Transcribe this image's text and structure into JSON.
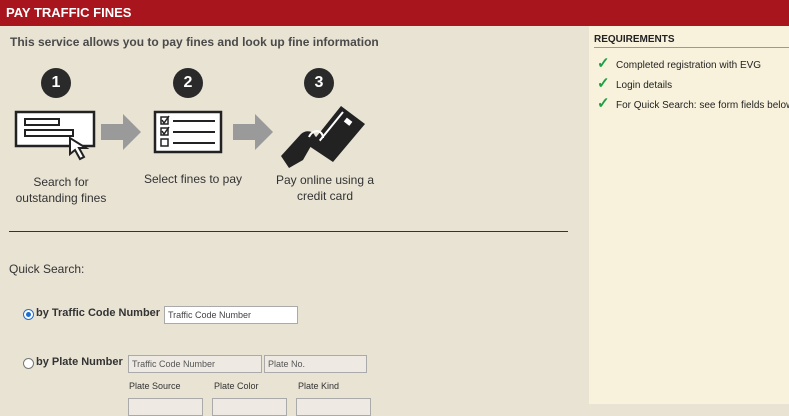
{
  "header": {
    "title": "PAY TRAFFIC FINES"
  },
  "intro": "This service allows you to pay fines and look up fine information",
  "steps": [
    {
      "number": "1",
      "line1": "Search for",
      "line2": "outstanding fines",
      "icon": "search-form-icon"
    },
    {
      "number": "2",
      "line1": "Select fines to pay",
      "line2": "",
      "icon": "checklist-icon"
    },
    {
      "number": "3",
      "line1": "Pay online using a",
      "line2": "credit card",
      "icon": "credit-card-hand-icon"
    }
  ],
  "quick_search": {
    "label": "Quick Search:",
    "by_traffic_code": {
      "label": "by Traffic Code Number",
      "placeholder": "Traffic Code Number",
      "selected": true
    },
    "by_plate": {
      "label": "by Plate Number",
      "traffic_code_placeholder": "Traffic Code Number",
      "plate_no_placeholder": "Plate No.",
      "plate_source_label": "Plate Source",
      "plate_color_label": "Plate Color",
      "plate_kind_label": "Plate Kind",
      "selected": false
    }
  },
  "requirements": {
    "title": "REQUIREMENTS",
    "items": [
      "Completed registration with EVG",
      "Login details",
      "For Quick Search: see form fields below"
    ]
  },
  "colors": {
    "header_bg": "#a9151c",
    "check": "#1e9e45",
    "radio_selected": "#1f6fd1"
  }
}
